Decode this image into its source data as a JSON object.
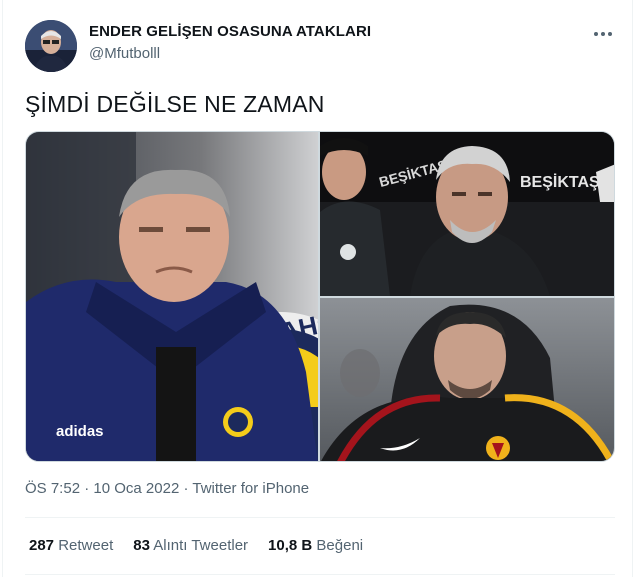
{
  "author": {
    "name": "ENDER GELİŞEN OSASUNA ATAKLARI",
    "handle": "@Mfutbolll"
  },
  "tweet": {
    "text": "ŞİMDİ DEĞİLSE NE ZAMAN"
  },
  "media": {
    "left_image_text": "ERBAHÇE",
    "sponsor": "adidas",
    "sponsor_board_1": "BEŞİKTAŞ",
    "sponsor_board_2": "BEŞİKTAŞ JK"
  },
  "meta": {
    "time": "ÖS 7:52",
    "date": "10 Oca 2022",
    "separator": "·",
    "source": "Twitter for iPhone"
  },
  "stats": {
    "retweets_count": "287",
    "retweets_label": "Retweet",
    "quotes_count": "83",
    "quotes_label": "Alıntı Tweetler",
    "likes_count": "10,8 B",
    "likes_label": "Beğeni"
  },
  "colors": {
    "text_primary": "#0f1419",
    "text_secondary": "#536471",
    "border": "#eff3f4",
    "fenerbahce_navy": "#1c2a5c",
    "fenerbahce_yellow": "#f4cc1a",
    "galatasaray_red": "#a4141c",
    "galatasaray_yellow": "#f0b21b"
  },
  "icons": {
    "more": "more-horizontal-icon"
  }
}
